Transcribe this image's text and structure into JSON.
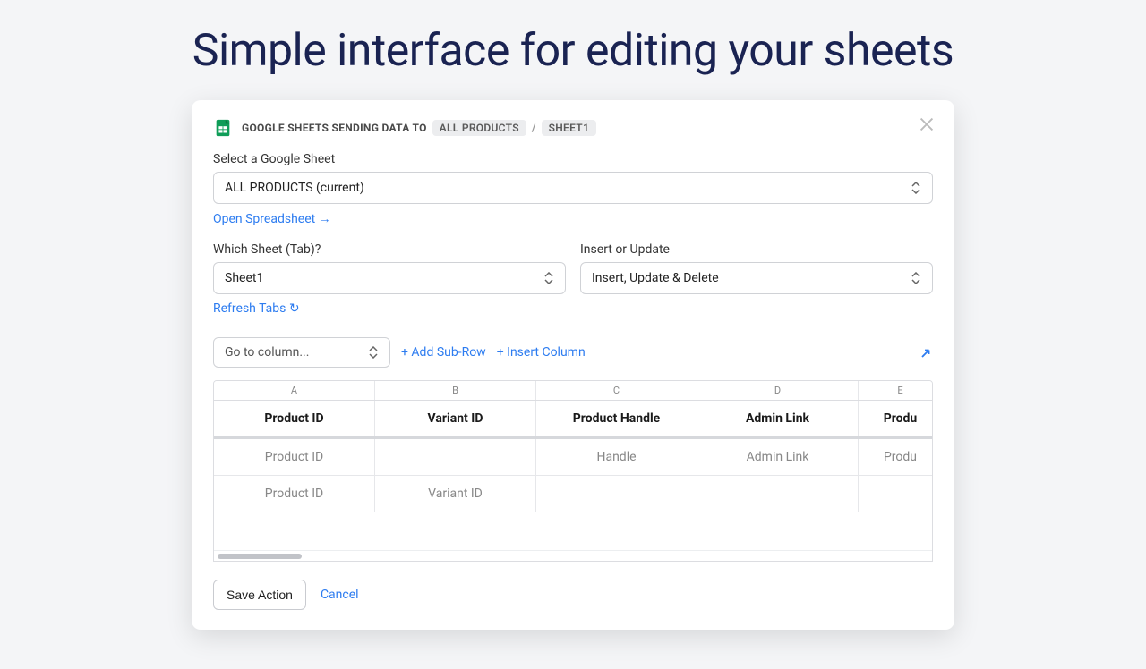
{
  "hero": "Simple interface for editing your sheets",
  "header": {
    "prefix": "GOOGLE SHEETS SENDING DATA TO",
    "chip1": "ALL PRODUCTS",
    "chip2": "SHEET1"
  },
  "form": {
    "selectSheetLabel": "Select a Google Sheet",
    "selectSheetValue": "ALL PRODUCTS (current)",
    "openSpreadsheet": "Open Spreadsheet →",
    "whichTabLabel": "Which Sheet (Tab)?",
    "whichTabValue": "Sheet1",
    "refreshTabs": "Refresh Tabs ↻",
    "insertUpdateLabel": "Insert or Update",
    "insertUpdateValue": "Insert, Update & Delete",
    "goToColumn": "Go to column...",
    "addSubRow": "+ Add Sub-Row",
    "insertColumn": "+ Insert Column"
  },
  "table": {
    "letters": [
      "A",
      "B",
      "C",
      "D",
      "E"
    ],
    "headers": [
      "Product ID",
      "Variant ID",
      "Product Handle",
      "Admin Link",
      "Produ"
    ],
    "rows": [
      [
        "Product ID",
        "",
        "Handle",
        "Admin Link",
        "Produ"
      ],
      [
        "Product ID",
        "Variant ID",
        "",
        "",
        ""
      ]
    ]
  },
  "footer": {
    "save": "Save Action",
    "cancel": "Cancel"
  }
}
